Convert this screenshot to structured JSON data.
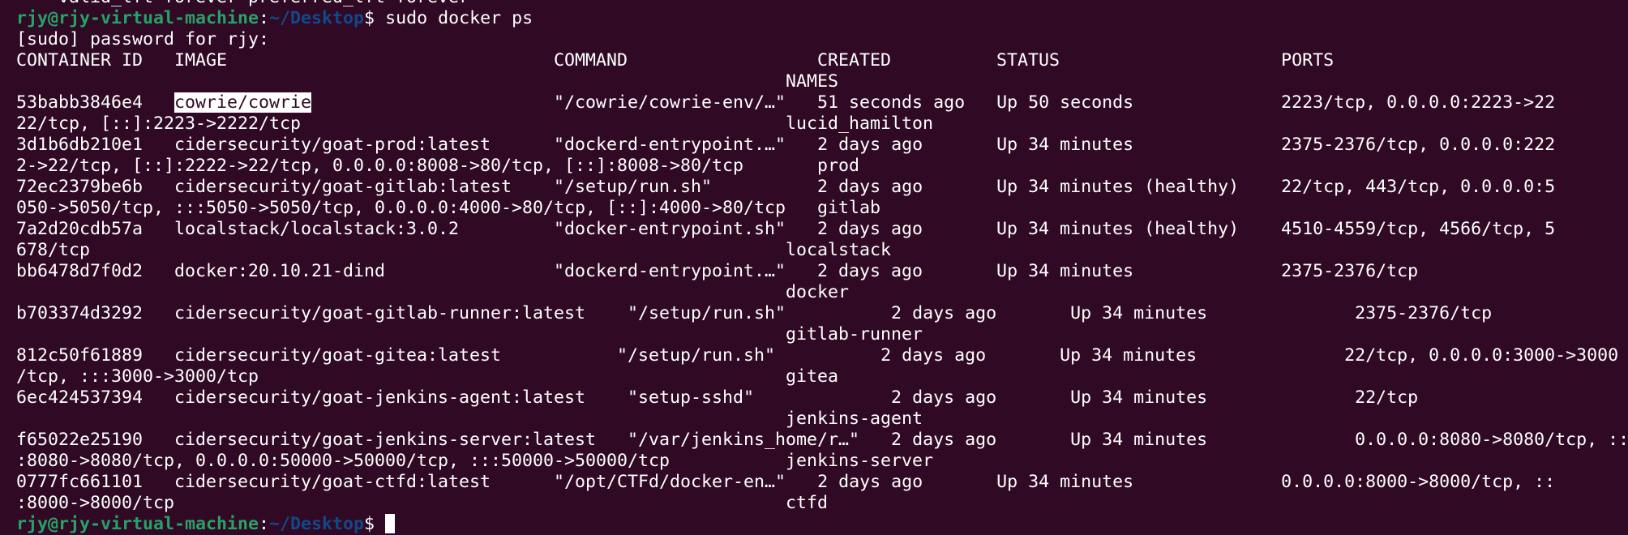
{
  "colors": {
    "background": "#300a24",
    "text": "#ffffff",
    "prompt_user": "#26a269",
    "prompt_path": "#12488b"
  },
  "scroll_line": "    valid_lft forever preferred_lft forever",
  "prompt": {
    "user_host": "rjy@rjy-virtual-machine",
    "path": "~/Desktop",
    "command": "sudo docker ps"
  },
  "sudo_line": "[sudo] password for rjy:",
  "header": {
    "main": "CONTAINER ID   IMAGE                               COMMAND                  CREATED          STATUS                     PORTS",
    "names": "                                                                         NAMES"
  },
  "rows": [
    {
      "id_col": "53babb3846e4   ",
      "image": "cowrie/cowrie",
      "rest": "                       \"/cowrie/cowrie-env/…\"   51 seconds ago   Up 50 seconds              2223/tcp, 0.0.0.0:2223->22",
      "wrap": "22/tcp, [::]:2223->2222/tcp                                              lucid_hamilton"
    },
    {
      "id_col": "3d1b6db210e1   ",
      "image": "cidersecurity/goat-prod:latest",
      "rest": "      \"dockerd-entrypoint.…\"   2 days ago       Up 34 minutes              2375-2376/tcp, 0.0.0.0:222",
      "wrap": "2->22/tcp, [::]:2222->22/tcp, 0.0.0.0:8008->80/tcp, [::]:8008->80/tcp       prod"
    },
    {
      "id_col": "72ec2379be6b   ",
      "image": "cidersecurity/goat-gitlab:latest",
      "rest": "    \"/setup/run.sh\"          2 days ago       Up 34 minutes (healthy)    22/tcp, 443/tcp, 0.0.0.0:5",
      "wrap": "050->5050/tcp, :::5050->5050/tcp, 0.0.0.0:4000->80/tcp, [::]:4000->80/tcp   gitlab"
    },
    {
      "id_col": "7a2d20cdb57a   ",
      "image": "localstack/localstack:3.0.2",
      "rest": "         \"docker-entrypoint.sh\"   2 days ago       Up 34 minutes (healthy)    4510-4559/tcp, 4566/tcp, 5",
      "wrap": "678/tcp                                                                  localstack"
    },
    {
      "id_col": "bb6478d7f0d2   ",
      "image": "docker:20.10.21-dind",
      "rest": "                \"dockerd-entrypoint.…\"   2 days ago       Up 34 minutes              2375-2376/tcp",
      "wrap": "                                                                         docker"
    },
    {
      "id_col": "b703374d3292   ",
      "image": "cidersecurity/goat-gitlab-runner:latest",
      "rest": "    \"/setup/run.sh\"          2 days ago       Up 34 minutes              2375-2376/tcp",
      "wrap": "                                                                         gitlab-runner"
    },
    {
      "id_col": "812c50f61889   ",
      "image": "cidersecurity/goat-gitea:latest",
      "rest": "           \"/setup/run.sh\"          2 days ago       Up 34 minutes              22/tcp, 0.0.0.0:3000->3000",
      "wrap": "/tcp, :::3000->3000/tcp                                                  gitea"
    },
    {
      "id_col": "6ec424537394   ",
      "image": "cidersecurity/goat-jenkins-agent:latest",
      "rest": "    \"setup-sshd\"             2 days ago       Up 34 minutes              22/tcp",
      "wrap": "                                                                         jenkins-agent"
    },
    {
      "id_col": "f65022e25190   ",
      "image": "cidersecurity/goat-jenkins-server:latest",
      "rest": "   \"/var/jenkins_home/r…\"   2 days ago       Up 34 minutes              0.0.0.0:8080->8080/tcp, ::",
      "wrap": ":8080->8080/tcp, 0.0.0.0:50000->50000/tcp, :::50000->50000/tcp           jenkins-server"
    },
    {
      "id_col": "0777fc661101   ",
      "image": "cidersecurity/goat-ctfd:latest",
      "rest": "      \"/opt/CTFd/docker-en…\"   2 days ago       Up 34 minutes              0.0.0.0:8000->8000/tcp, ::",
      "wrap": ":8000->8000/tcp                                                          ctfd"
    }
  ],
  "final_prompt": {
    "user_host": "rjy@rjy-virtual-machine",
    "path": "~/Desktop"
  }
}
